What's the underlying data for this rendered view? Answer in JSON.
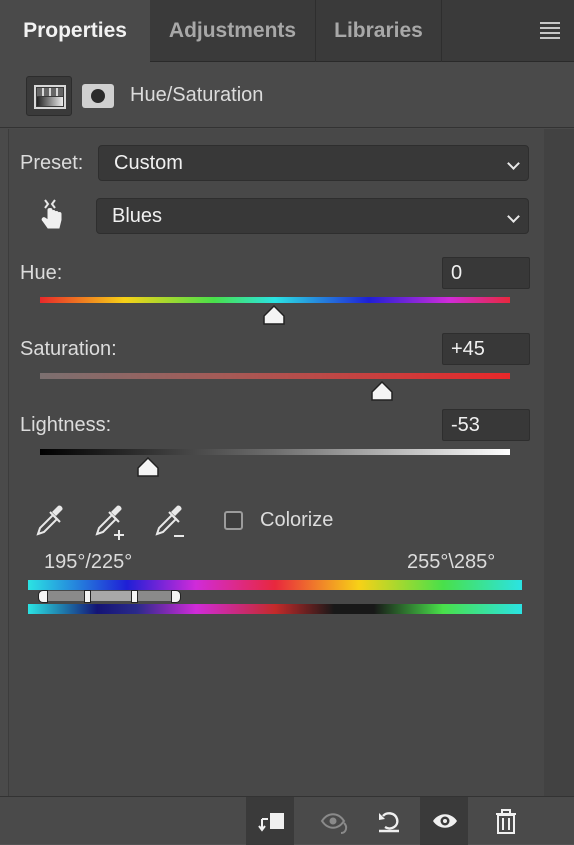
{
  "tabs": [
    {
      "label": "Properties",
      "active": true
    },
    {
      "label": "Adjustments",
      "active": false
    },
    {
      "label": "Libraries",
      "active": false
    }
  ],
  "header": {
    "title": "Hue/Saturation",
    "icons": [
      "adjustment-layer-icon",
      "layer-mask-icon"
    ]
  },
  "preset": {
    "label": "Preset:",
    "value": "Custom"
  },
  "channel": {
    "value": "Blues",
    "icon": "targeted-adjustment-hand-icon"
  },
  "hue": {
    "label": "Hue:",
    "value": "0",
    "level": 0
  },
  "saturation": {
    "label": "Saturation:",
    "value": "+45",
    "level": 45
  },
  "lightness": {
    "label": "Lightness:",
    "value": "-53",
    "level": -53
  },
  "eyedroppers": [
    "eyedropper-icon",
    "eyedropper-plus-icon",
    "eyedropper-minus-icon"
  ],
  "colorize": {
    "label": "Colorize",
    "checked": false
  },
  "range": {
    "left": "195°/225°",
    "right": "255°\\285°"
  },
  "bottom_bar": [
    "clip-to-layer-icon",
    "view-previous-state-icon",
    "reset-icon",
    "visibility-icon",
    "delete-icon"
  ],
  "colors": {
    "panel": "#4a4a4a",
    "field": "#383838",
    "text": "#dcdcdc",
    "accent_red": "#e8282a"
  }
}
